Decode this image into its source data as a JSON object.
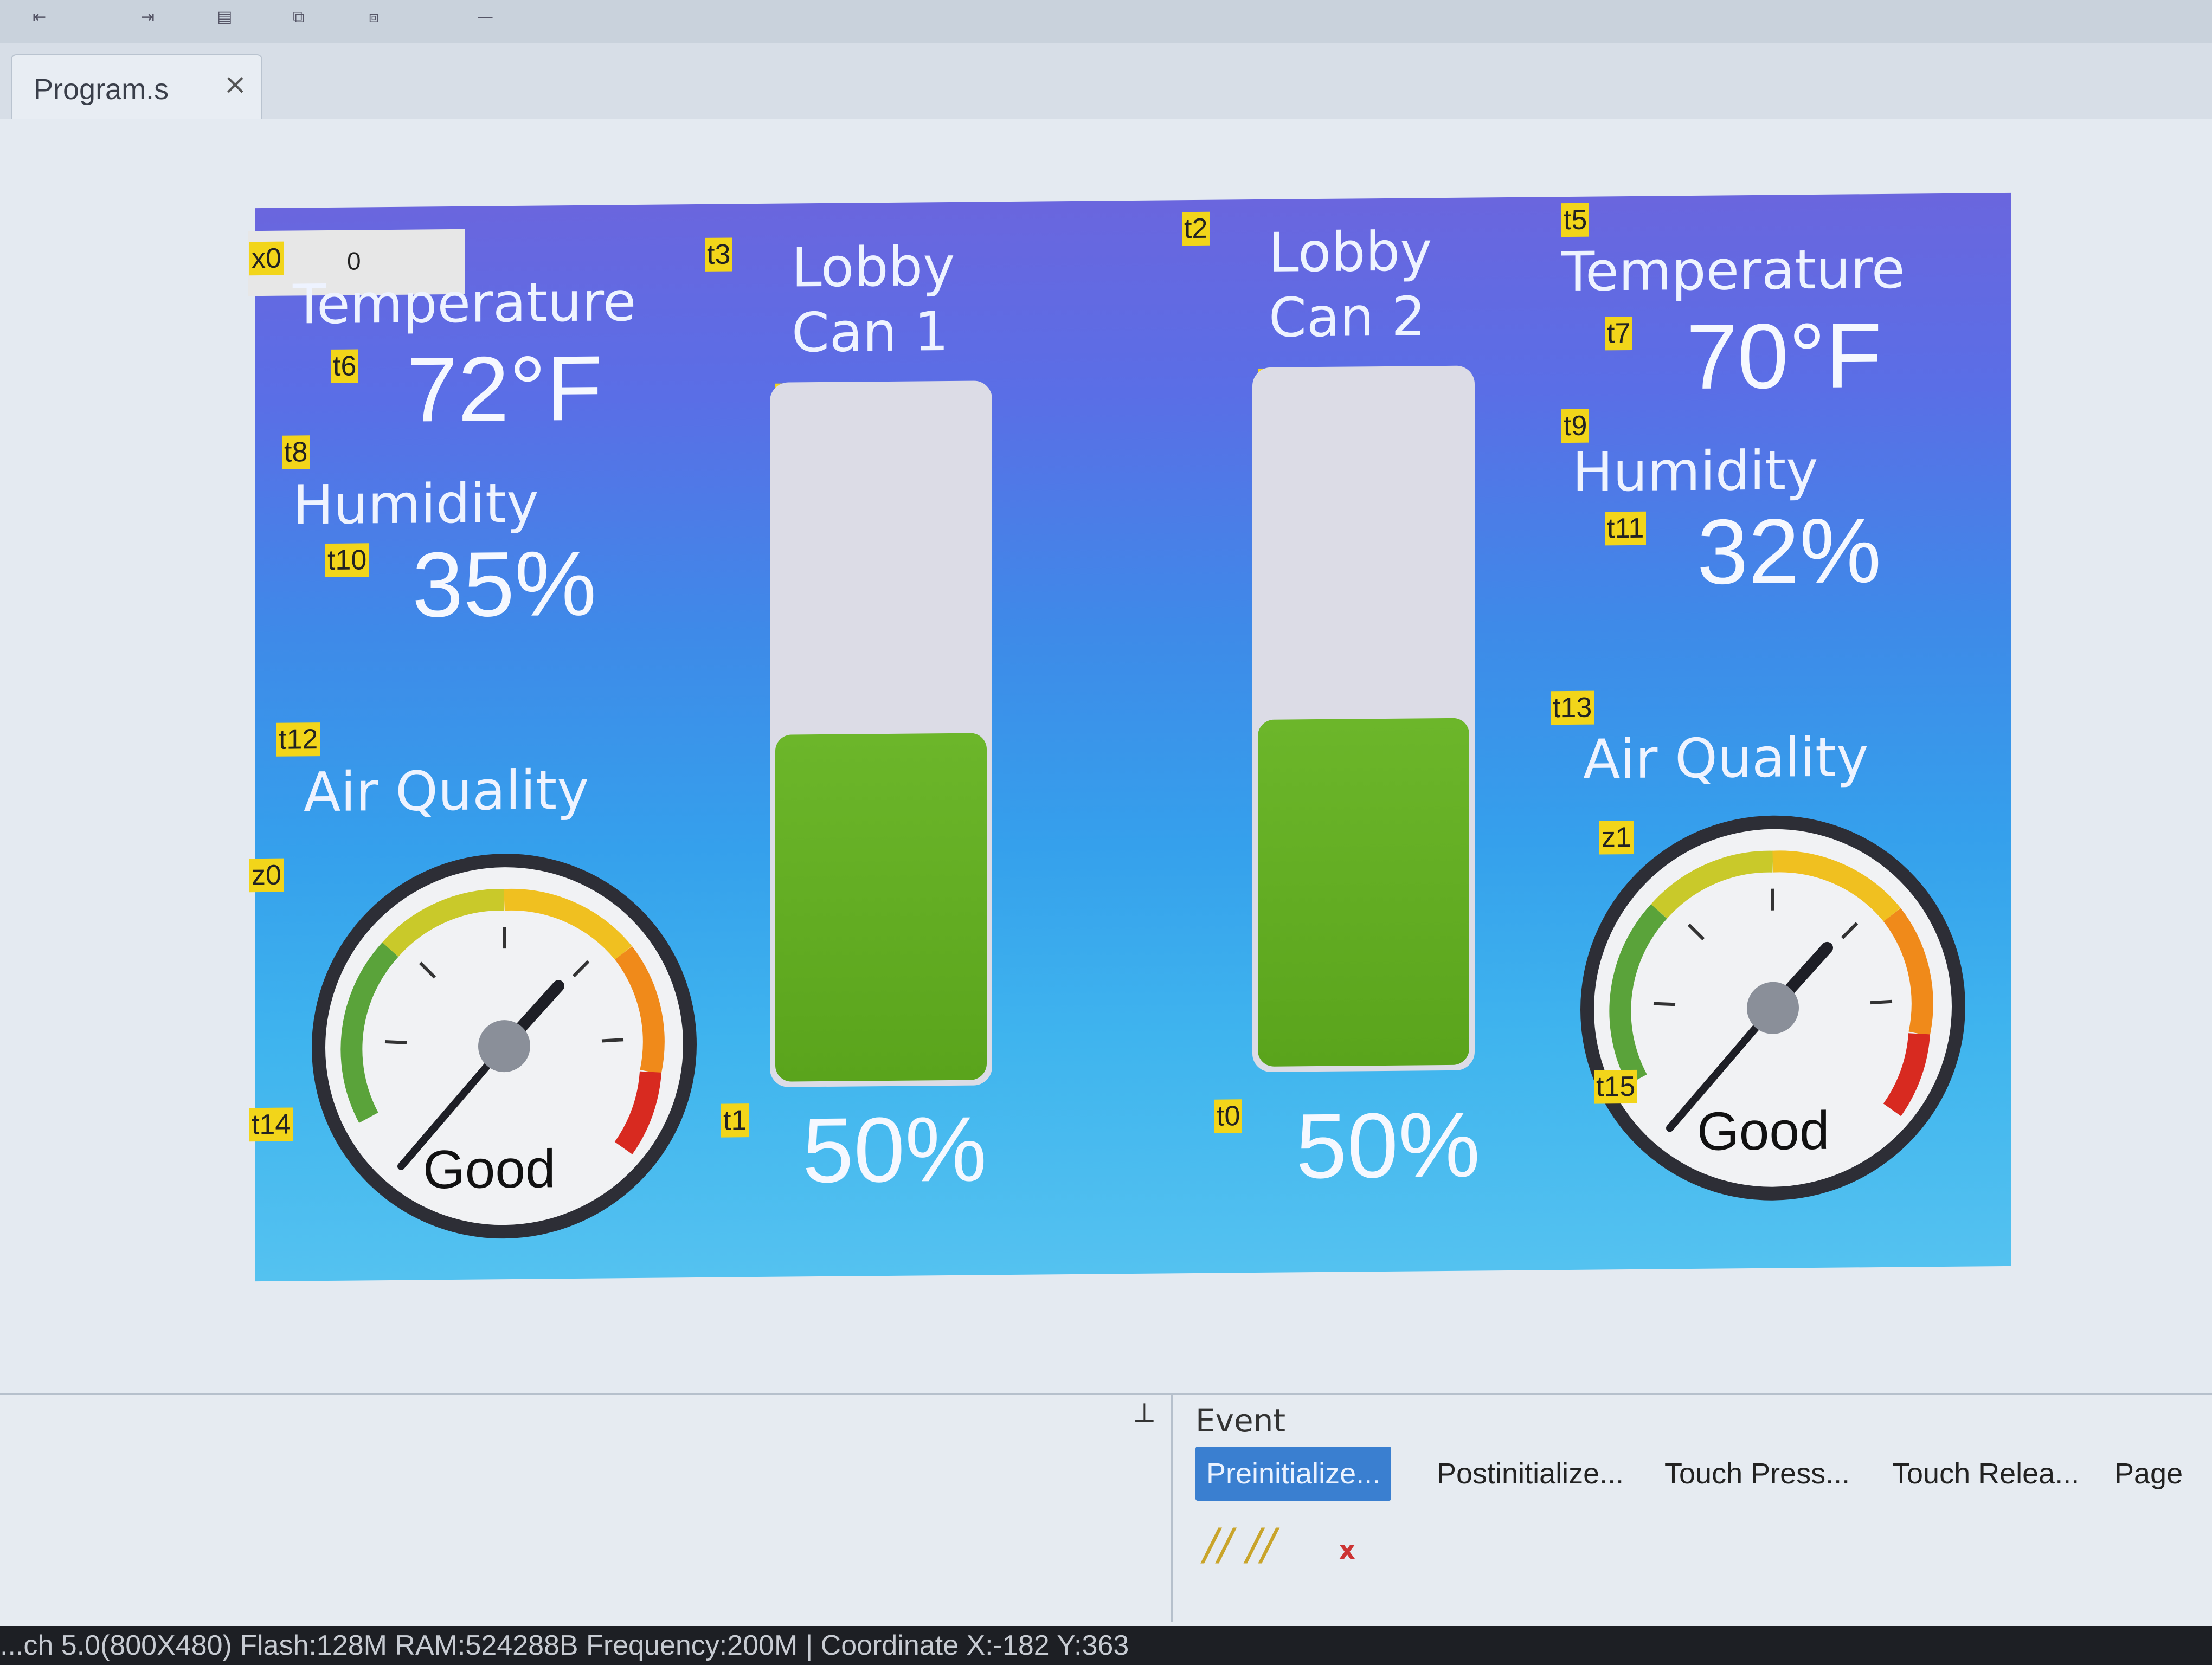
{
  "tab": {
    "label": "Program.s",
    "close": "×"
  },
  "screen": {
    "x0": {
      "tag": "x0",
      "value": "0"
    },
    "left": {
      "temp_label": "Temperature",
      "temp_value": "72°F",
      "temp_tag": "t6",
      "hum_tag_label": "t8",
      "hum_label": "Humidity",
      "hum_value_tag": "t10",
      "hum_value": "35%",
      "aq_tag": "t12",
      "aq_label": "Air Quality",
      "gauge_tag": "z0",
      "gauge_text_tag": "t14",
      "gauge_text": "Good"
    },
    "can1": {
      "title_tag": "t3",
      "title_line1": "Lobby",
      "title_line2": "Can 1",
      "bar_tag": "j0",
      "fill_percent": 50,
      "value_tag": "t1",
      "value": "50%"
    },
    "can2": {
      "title_tag": "t2",
      "title_line1": "Lobby",
      "title_line2": "Can 2",
      "bar_tag": "j1",
      "fill_percent": 50,
      "value_tag": "t0",
      "value": "50%"
    },
    "right": {
      "temp_tag_label": "t5",
      "temp_label": "Temperature",
      "temp_tag": "t7",
      "temp_value": "70°F",
      "hum_tag_label": "t9",
      "hum_label": "Humidity",
      "hum_value_tag": "t11",
      "hum_value": "32%",
      "aq_tag": "t13",
      "aq_label": "Air Quality",
      "gauge_tag": "z1",
      "gauge_text_tag": "t15",
      "gauge_text": "Good"
    }
  },
  "event": {
    "title": "Event",
    "pin": "⊥",
    "tabs": [
      "Preinitialize...",
      "Postinitialize...",
      "Touch Press...",
      "Touch Relea...",
      "Page"
    ],
    "code_glyphs": "//  //",
    "code_x": "x"
  },
  "status": {
    "text": "...ch 5.0(800X480) Flash:128M RAM:524288B Frequency:200M |  Coordinate X:-182  Y:363"
  }
}
